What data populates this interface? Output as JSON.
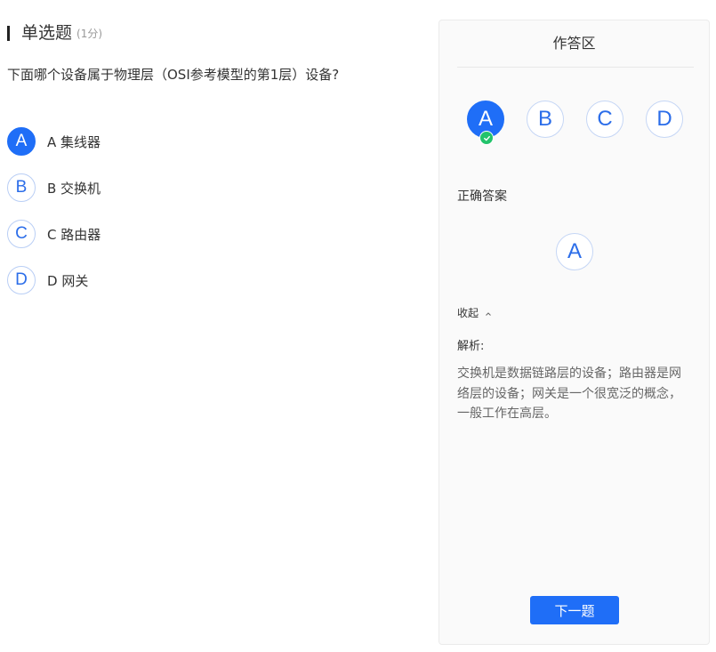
{
  "question": {
    "type_label": "单选题",
    "score": "(1分)",
    "stem": "下面哪个设备属于物理层（OSI参考模型的第1层）设备?",
    "options": [
      {
        "letter": "A",
        "text": "A 集线器",
        "selected": true
      },
      {
        "letter": "B",
        "text": "B 交换机",
        "selected": false
      },
      {
        "letter": "C",
        "text": "C 路由器",
        "selected": false
      },
      {
        "letter": "D",
        "text": "D 网关",
        "selected": false
      }
    ]
  },
  "answer_panel": {
    "title": "作答区",
    "choices": [
      {
        "letter": "A",
        "selected": true,
        "status_icon": "check-circle-icon"
      },
      {
        "letter": "B",
        "selected": false
      },
      {
        "letter": "C",
        "selected": false
      },
      {
        "letter": "D",
        "selected": false
      }
    ],
    "correct_label": "正确答案",
    "correct_answer": "A",
    "collapse_label": "收起",
    "analysis_label": "解析:",
    "analysis_text": "交换机是数据链路层的设备；路由器是网络层的设备；网关是一个很宽泛的概念，一般工作在高层。",
    "next_button": "下一题"
  },
  "colors": {
    "accent": "#1f6ef7",
    "correct": "#22c36b",
    "panel_bg": "#fafafa"
  }
}
